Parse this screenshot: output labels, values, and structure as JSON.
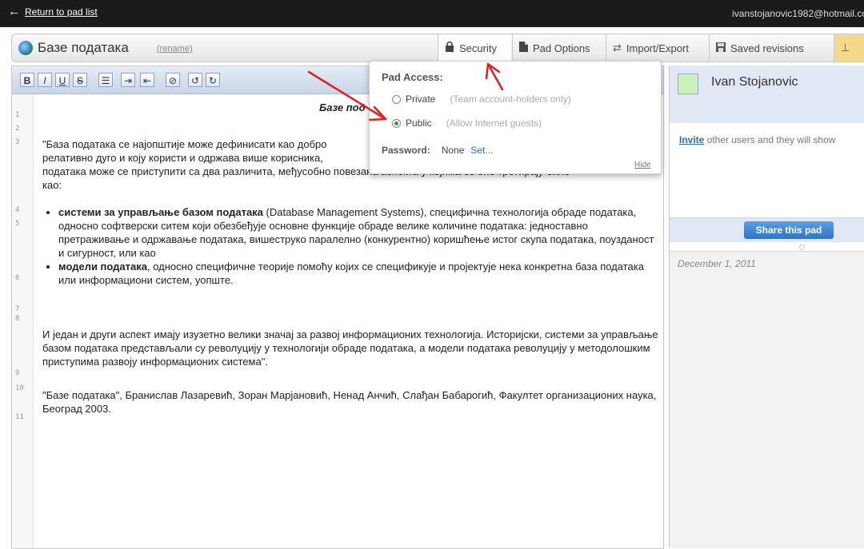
{
  "topbar": {
    "back_label": "Return to pad list",
    "user_email": "ivanstojanovic1982@hotmail.co"
  },
  "titlebar": {
    "pad_name": "Базе података",
    "rename_label": "(rename)",
    "tabs": [
      {
        "label": "Security",
        "icon": "lock-icon"
      },
      {
        "label": "Pad Options",
        "icon": "document-icon"
      },
      {
        "label": "Import/Export",
        "icon": "transfer-arrows-icon"
      },
      {
        "label": "Saved revisions",
        "icon": "save-icon"
      }
    ]
  },
  "toolbar": {
    "buttons": [
      {
        "name": "bold",
        "glyph": "B"
      },
      {
        "name": "italic",
        "glyph": "I"
      },
      {
        "name": "underline",
        "glyph": "U"
      },
      {
        "name": "strikethrough",
        "glyph": "S"
      },
      {
        "name": "bullet-list",
        "glyph": "☰"
      },
      {
        "name": "indent",
        "glyph": "⇥"
      },
      {
        "name": "outdent",
        "glyph": "⇤"
      },
      {
        "name": "clear-authorship",
        "glyph": "⊘"
      },
      {
        "name": "undo",
        "glyph": "↺"
      },
      {
        "name": "redo",
        "glyph": "↻"
      }
    ]
  },
  "document": {
    "line_numbers": [
      "1",
      "2",
      "3",
      "4",
      "5",
      "6",
      "7",
      "8",
      "9",
      "10",
      "11"
    ],
    "title": "Базе под",
    "para3_line1": "\"База података се најопштије може дефинисати као добро",
    "para3_line2": "релативно дуго и коју користи и одржава више корисника, ",
    "para3_line3": "података може се приступити са два различита, међусобно повезана аспекта у којима се оне третирају било",
    "para3_line4": "као:",
    "bullet1_bold": "системи за управљање базом података",
    "bullet1_rest": " (Database Management Systems), специфична технологија обраде података, односно софтверски ситем који обезбеђује основне функције обраде велике количине података: једноставно претраживање и одржавање података, вишеструко паралелно (конкурентно) коришћење истог скупа података, поузданост и сигурност, или као",
    "bullet2_bold": "модели података",
    "bullet2_rest": ", односно специфичне теорије помоћу којих се спецификује и пројектује нека конкретна база података или информациони систем, уопште.",
    "para8": "И један и други аспект имају изузетно велики значај за развој информационих технологија. Историјски, системи за управљање базом података представљали су револуцију у технологији обраде података, а модели података револуцију у методолошким приступима развоју информационих система\".",
    "para10": "\"Базе података\", Бранислав Лазаревић, Зоран Марјановић, Ненад Анчић, Слађан Бабарогић, Факултет организационих наука, Београд 2003."
  },
  "security_popup": {
    "heading": "Pad Access:",
    "private_label": "Private",
    "private_hint": "(Team account-holders only)",
    "public_label": "Public",
    "public_hint": "(Allow Internet guests)",
    "selected": "Public",
    "password_label": "Password:",
    "password_value": "None",
    "password_set": "Set...",
    "hide_label": "Hide"
  },
  "right_panel": {
    "user_name": "Ivan Stojanovic",
    "user_color": "#c8f0b8",
    "invite_link": "Invite",
    "invite_rest": " other users and they will show",
    "share_button": "Share this pad",
    "chat_date": "December 1, 2011"
  },
  "colors": {
    "accent_blue": "#2f74c7",
    "annotation_red": "#e02020"
  }
}
